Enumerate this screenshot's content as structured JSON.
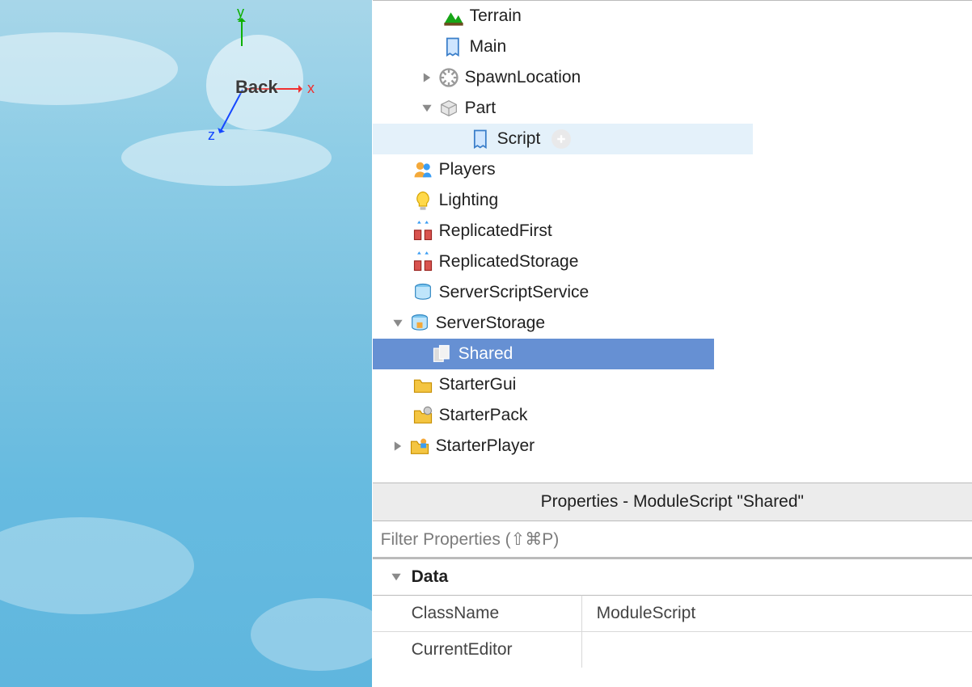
{
  "viewport": {
    "back_label": "Back",
    "axis_x": "x",
    "axis_y": "y",
    "axis_z": "z"
  },
  "explorer": {
    "items": [
      {
        "name": "Terrain"
      },
      {
        "name": "Main"
      },
      {
        "name": "SpawnLocation"
      },
      {
        "name": "Part"
      },
      {
        "name": "Script"
      },
      {
        "name": "Players"
      },
      {
        "name": "Lighting"
      },
      {
        "name": "ReplicatedFirst"
      },
      {
        "name": "ReplicatedStorage"
      },
      {
        "name": "ServerScriptService"
      },
      {
        "name": "ServerStorage"
      },
      {
        "name": "Shared"
      },
      {
        "name": "StarterGui"
      },
      {
        "name": "StarterPack"
      },
      {
        "name": "StarterPlayer"
      }
    ]
  },
  "properties": {
    "title": "Properties - ModuleScript \"Shared\"",
    "filter_placeholder": "Filter Properties (⇧⌘P)",
    "category": "Data",
    "rows": [
      {
        "name": "ClassName",
        "value": "ModuleScript"
      },
      {
        "name": "CurrentEditor",
        "value": ""
      }
    ]
  }
}
